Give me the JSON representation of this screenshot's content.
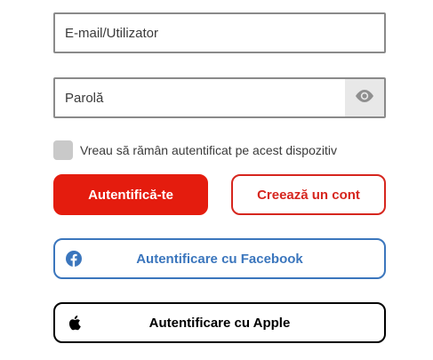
{
  "login_form": {
    "email": {
      "placeholder": "E-mail/Utilizator",
      "value": ""
    },
    "password": {
      "placeholder": "Parolă",
      "value": "",
      "toggle_icon": "eye-icon"
    },
    "remember_me": {
      "label": "Vreau să rămân autentificat pe acest dispozitiv",
      "checked": false
    },
    "buttons": {
      "login_label": "Autentifică-te",
      "create_account_label": "Creează un cont",
      "facebook_label": "Autentificare cu Facebook",
      "apple_label": "Autentificare cu Apple"
    }
  },
  "icons": {
    "facebook": "facebook-icon",
    "apple": "apple-icon",
    "eye": "eye-icon"
  },
  "colors": {
    "primary_red": "#e41c0e",
    "outline_red": "#d6261e",
    "facebook_blue": "#3b76bd",
    "apple_black": "#000000",
    "field_border": "#8a8a8a",
    "checkbox_gray": "#c9c9c9"
  }
}
